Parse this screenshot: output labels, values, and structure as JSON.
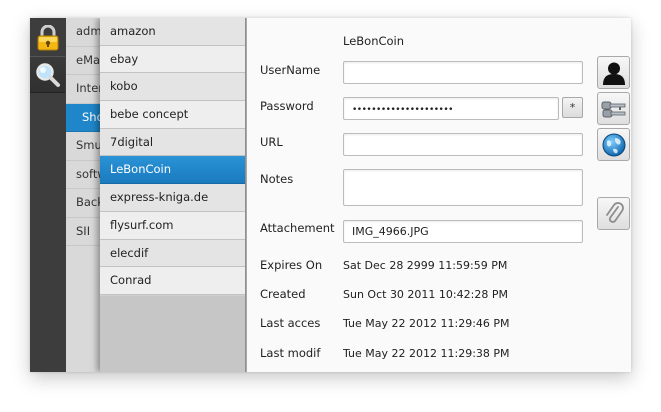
{
  "tools": [
    {
      "icon": "lock-icon"
    },
    {
      "icon": "search-icon"
    }
  ],
  "categories": [
    {
      "label": "adm"
    },
    {
      "label": "eMai"
    },
    {
      "label": "Inter"
    },
    {
      "label": "Sho",
      "active": true
    },
    {
      "label": "Smu"
    },
    {
      "label": "softw"
    },
    {
      "label": "Back"
    },
    {
      "label": "SII"
    }
  ],
  "entries": [
    {
      "label": "amazon"
    },
    {
      "label": "ebay"
    },
    {
      "label": "kobo"
    },
    {
      "label": "bebe concept"
    },
    {
      "label": "7digital"
    },
    {
      "label": "LeBonCoin",
      "active": true
    },
    {
      "label": "express-kniga.de"
    },
    {
      "label": "flysurf.com"
    },
    {
      "label": "elecdif"
    },
    {
      "label": "Conrad"
    }
  ],
  "detail": {
    "title": "LeBonCoin",
    "username_label": "UserName",
    "username_value": "",
    "password_label": "Password",
    "password_dots": "•••••••••••••••••••••",
    "reveal_label": "*",
    "url_label": "URL",
    "url_value": "",
    "notes_label": "Notes",
    "notes_value": "",
    "attachment_label": "Attachement",
    "attachment_value": "IMG_4966.JPG",
    "expires_label": "Expires On",
    "expires_value": "Sat Dec 28 2999 11:59:59 PM",
    "created_label": "Created",
    "created_value": "Sun Oct 30 2011 10:42:28 PM",
    "last_access_label": "Last acces",
    "last_access_value": "Tue May 22 2012 11:29:46 PM",
    "last_modif_label": "Last modif",
    "last_modif_value": "Tue May 22 2012 11:29:38 PM"
  },
  "side_buttons": [
    {
      "icon": "user-silhouette-icon"
    },
    {
      "icon": "keys-icon"
    },
    {
      "icon": "globe-icon"
    },
    {
      "icon": "paperclip-icon"
    }
  ],
  "colors": {
    "accent": "#1f86c9",
    "toolstrip": "#3d3d3d"
  }
}
